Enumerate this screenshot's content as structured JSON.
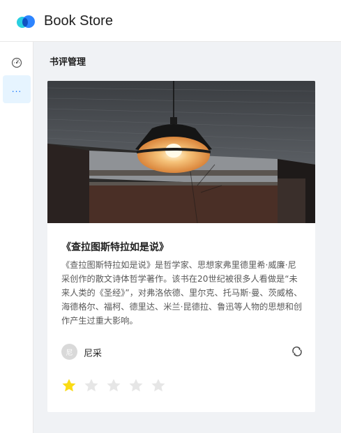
{
  "header": {
    "app_title": "Book Store",
    "logo_icon": "dual-blob-logo"
  },
  "sidebar": {
    "items": [
      {
        "icon": "dashboard-gauge-icon",
        "selected": false
      },
      {
        "label": "...",
        "selected": true
      }
    ]
  },
  "page": {
    "title": "书评管理"
  },
  "card": {
    "title": "《查拉图斯特拉如是说》",
    "description": "《查拉图斯特拉如是说》是哲学家、思想家弗里德里希·威廉·尼采创作的散文诗体哲学著作。该书在20世纪被很多人看做是“未来人类的《圣经》”，对弗洛依德、里尔克、托马斯·曼、茨威格、海德格尔、福柯、德里达、米兰·昆德拉、鲁迅等人物的思想和创作产生过重大影响。",
    "author": {
      "avatar_text": "尼",
      "name": "尼采"
    },
    "rating": {
      "value": 1,
      "max": 5
    }
  },
  "colors": {
    "accent": "#1677ff",
    "star_filled": "#fadb14",
    "star_empty": "#e6e6e6"
  }
}
